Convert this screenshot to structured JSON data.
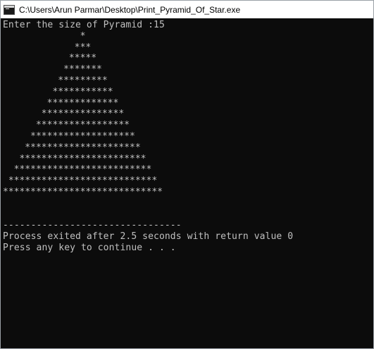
{
  "window": {
    "title": "C:\\Users\\Arun Parmar\\Desktop\\Print_Pyramid_Of_Star.exe",
    "icon": "console-app-icon"
  },
  "console": {
    "prompt": "Enter the size of Pyramid :15",
    "pyramid": [
      "              *",
      "             ***",
      "            *****",
      "           *******",
      "          *********",
      "         ***********",
      "        *************",
      "       ***************",
      "      *****************",
      "     *******************",
      "    *********************",
      "   ***********************",
      "  *************************",
      " ***************************",
      "*****************************"
    ],
    "blank": "",
    "separator": "--------------------------------",
    "exit_message": "Process exited after 2.5 seconds with return value 0",
    "continue_message": "Press any key to continue . . ."
  }
}
